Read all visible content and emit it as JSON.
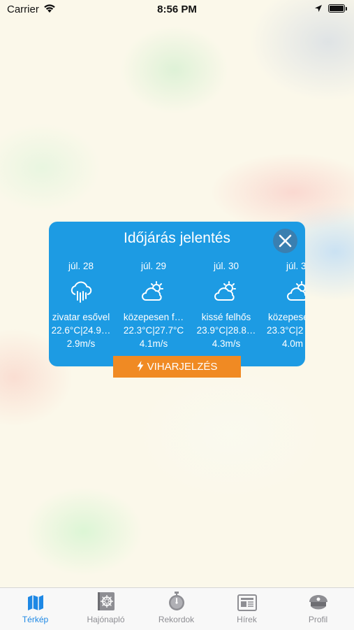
{
  "status_bar": {
    "carrier": "Carrier",
    "time": "8:56 PM"
  },
  "modal": {
    "title": "Időjárás jelentés",
    "close_icon": "close-icon",
    "days": [
      {
        "date": "júl. 28",
        "icon": "rain-cloud-icon",
        "description": "zivatar esővel",
        "temperature": "22.6°C|24.9…",
        "wind": "2.9m/s"
      },
      {
        "date": "júl. 29",
        "icon": "partly-cloudy-icon",
        "description": "közepesen f…",
        "temperature": "22.3°C|27.7°C",
        "wind": "4.1m/s"
      },
      {
        "date": "júl. 30",
        "icon": "partly-cloudy-icon",
        "description": "kissé felhős",
        "temperature": "23.9°C|28.8…",
        "wind": "4.3m/s"
      },
      {
        "date": "júl. 3",
        "icon": "partly-cloudy-icon",
        "description": "közepesen",
        "temperature": "23.3°C|2",
        "wind": "4.0m"
      }
    ],
    "storm_button": {
      "label": "VIHARJELZÉS",
      "icon": "lightning-icon"
    }
  },
  "tab_bar": {
    "items": [
      {
        "label": "Térkép",
        "icon": "map-icon",
        "active": true
      },
      {
        "label": "Hajónapló",
        "icon": "logbook-icon",
        "active": false
      },
      {
        "label": "Rekordok",
        "icon": "stopwatch-icon",
        "active": false
      },
      {
        "label": "Hírek",
        "icon": "newspaper-icon",
        "active": false
      },
      {
        "label": "Profil",
        "icon": "captain-hat-icon",
        "active": false
      }
    ]
  },
  "colors": {
    "modal_bg": "#1d9be3",
    "storm_button": "#f08a23",
    "tab_active": "#1e88e5",
    "tab_inactive": "#8e8e93"
  }
}
